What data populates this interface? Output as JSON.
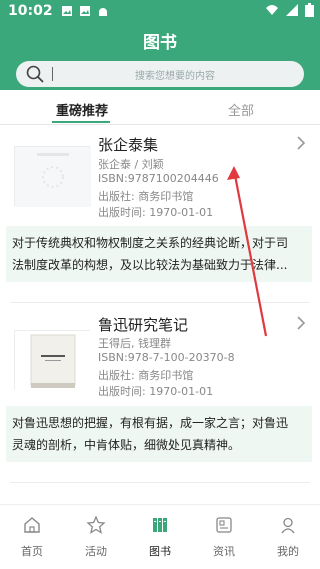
{
  "status_bar": {
    "time": "10:02",
    "left_icons": [
      "image-icon",
      "image-icon",
      "android-icon"
    ],
    "right_icons": [
      "wifi-icon",
      "signal-icon",
      "battery-icon"
    ]
  },
  "app_bar": {
    "title": "图书"
  },
  "search": {
    "placeholder": "搜索您想要的内容"
  },
  "tabs": [
    {
      "label": "重磅推荐",
      "active": true
    },
    {
      "label": "全部",
      "active": false
    }
  ],
  "books": [
    {
      "title": "张企泰集",
      "authors": "张企泰 / 刘颖",
      "isbn": "ISBN:9787100204446",
      "publisher": "出版社: 商务印书馆",
      "pub_date": "出版时间: 1970-01-01",
      "description_line1": "对于传统典权和物权制度之关系的经典论断，对于司",
      "description_line2": "法制度改革的构想，及以比较法为基础致力于法律..."
    },
    {
      "title": "鲁迅研究笔记",
      "authors": "王得后, 钱理群",
      "isbn": "ISBN:978-7-100-20370-8",
      "publisher": "出版社: 商务印书馆",
      "pub_date": "出版时间: 1970-01-01",
      "description_line1": "对鲁迅思想的把握，有根有据，成一家之言；对鲁迅",
      "description_line2": "灵魂的剖析，中肯体贴，细微处见真精神。"
    }
  ],
  "bottom_nav": [
    {
      "label": "首页",
      "icon": "home-icon",
      "active": false
    },
    {
      "label": "活动",
      "icon": "star-icon",
      "active": false
    },
    {
      "label": "图书",
      "icon": "books-icon",
      "active": true
    },
    {
      "label": "资讯",
      "icon": "news-icon",
      "active": false
    },
    {
      "label": "我的",
      "icon": "profile-icon",
      "active": false
    }
  ],
  "colors": {
    "brand": "#3aa87a",
    "desc_bg": "#eef7f1",
    "active_nav_bg": "#e2e6f5",
    "annotation": "#e0393e"
  }
}
